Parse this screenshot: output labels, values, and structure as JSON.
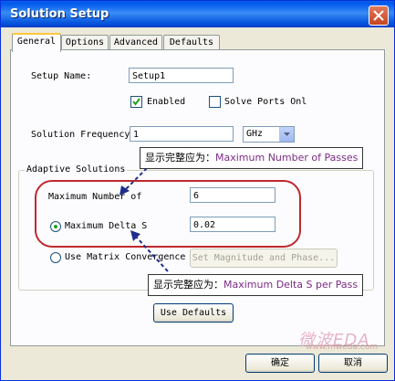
{
  "window": {
    "title": "Solution Setup"
  },
  "tabs": [
    {
      "label": "General",
      "active": true
    },
    {
      "label": "Options",
      "active": false
    },
    {
      "label": "Advanced",
      "active": false
    },
    {
      "label": "Defaults",
      "active": false
    }
  ],
  "general": {
    "setup_name_label": "Setup Name:",
    "setup_name_value": "Setup1",
    "enabled_label": "Enabled",
    "enabled_checked": true,
    "solve_ports_label": "Solve Ports Onl",
    "solve_ports_checked": false,
    "solution_frequency_label": "Solution Frequency",
    "solution_frequency_value": "1",
    "frequency_unit": "GHz",
    "adaptive_group_title": "Adaptive Solutions",
    "max_passes_label": "Maximum Number of",
    "max_passes_value": "6",
    "max_delta_s_label": "Maximum Delta S",
    "max_delta_s_value": "0.02",
    "max_delta_s_selected": true,
    "matrix_conv_label": "Use Matrix Convergence",
    "matrix_conv_selected": false,
    "set_magnitude_label": "Set Magnitude and Phase...",
    "use_defaults_label": "Use Defaults"
  },
  "annotations": {
    "callout1_prefix": "显示完整应为：",
    "callout1_text": "Maximum Number of Passes",
    "callout2_prefix": "显示完整应为：",
    "callout2_text": "Maximum Delta S per Pass",
    "highlight_color": "#c0282d",
    "arrow_color": "#1e2d8c"
  },
  "footer": {
    "ok_label": "确定",
    "cancel_label": "取消"
  },
  "watermark": {
    "brand": "微波EDA",
    "url": "www.mweda.com"
  }
}
